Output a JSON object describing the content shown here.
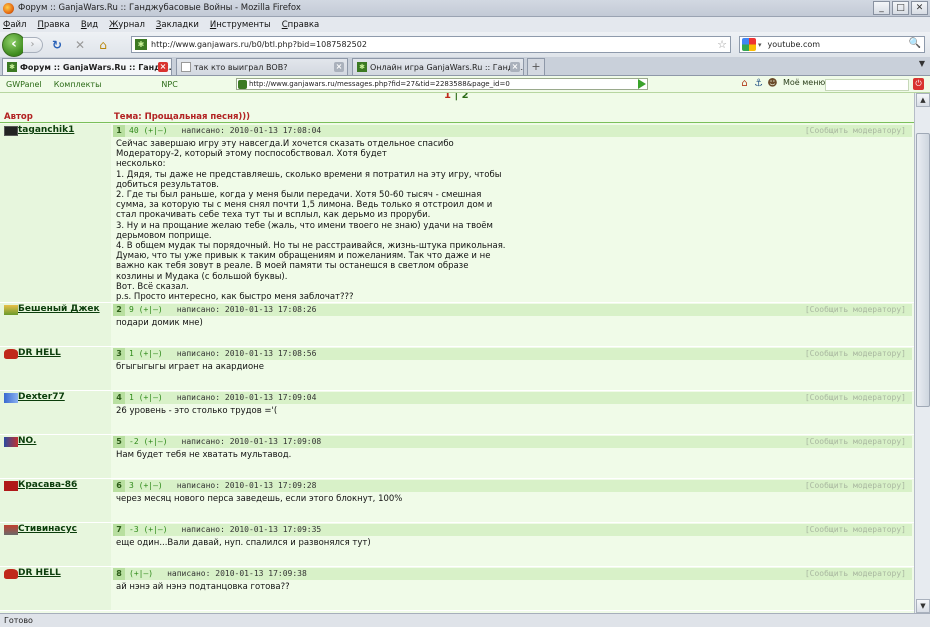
{
  "window": {
    "title": "Форум :: GanjaWars.Ru :: Ганджубасовые Войны - Mozilla Firefox",
    "buttons": [
      "_",
      "□",
      "✕"
    ]
  },
  "menu": [
    {
      "u": "Ф",
      "rest": "айл"
    },
    {
      "u": "П",
      "rest": "равка"
    },
    {
      "u": "В",
      "rest": "ид"
    },
    {
      "u": "Ж",
      "rest": "урнал"
    },
    {
      "u": "З",
      "rest": "акладки"
    },
    {
      "u": "И",
      "rest": "нструменты"
    },
    {
      "u": "С",
      "rest": "правка"
    }
  ],
  "nav": {
    "back": "‹",
    "forward": "›",
    "reload": "↻",
    "stop": "✕",
    "home": "⌂",
    "url": "http://www.ganjawars.ru/b0/btl.php?bid=1087582502",
    "search_value": "youtube.com"
  },
  "tabs": [
    {
      "label": "Форум :: GanjaWars.Ru :: Гандж...",
      "active": true
    },
    {
      "label": "так кто выиграл ВОВ?",
      "active": false
    },
    {
      "label": "Онлайн игра GanjaWars.Ru :: Гандж...",
      "active": false
    }
  ],
  "gwpanel": {
    "links": [
      "GWPanel",
      "Комплекты",
      "NPC"
    ],
    "url": "http://www.ganjawars.ru/messages.php?fid=27&tid=2283588&page_id=0",
    "my_menu": "Моё меню"
  },
  "forum": {
    "pager": {
      "current": "1",
      "next": "2"
    },
    "head_author": "Автор",
    "head_topic": "Тема: Прощальная песня)))",
    "report_label": "[Сообщить модератору]",
    "written_label": "написано:",
    "posts": [
      {
        "author": "taganchik1",
        "num": "1",
        "rating": "40 (+|—)",
        "date": "2010-01-13 17:08:04",
        "text": "Сейчас завершаю игру эту навсегда.И хочется сказать отдельное спасибо\nМодератору-2, который этому поспособствовал. Хотя будет\nнесколько:\n1. Дядя, ты даже не представляешь, сколько времени я потратил на эту игру, чтобы\nдобиться результатов.\n2. Где ты был раньше, когда у меня были передачи. Хотя 50-60 тысяч - смешная\nсумма, за которую ты с меня снял почти 1,5 лимона. Ведь только я отстроил дом и\nстал прокачивать себе теха тут ты и всплыл, как дерьмо из проруби.\n3. Ну и на прощание желаю тебе (жаль, что имени твоего не знаю) удачи на твоём\nдерьмовом поприще.\n4. В общем мудак ты порядочный. Но ты не расстраивайся, жизнь-штука прикольная.\nДумаю, что ты уже привык к таким обращениям и пожеланиям. Так что даже и не\nважно как тебя зовут в реале. В моей памяти ты останешся в светлом образе\nкозлины и Мудака (с большой буквы).\nВот. Всё сказал.\np.s. Просто интересно, как быстро меня заблочат???"
      },
      {
        "author": "Бешеный Джек",
        "num": "2",
        "rating": "9 (+|—)",
        "date": "2010-01-13 17:08:26",
        "text": "подари домик мне)"
      },
      {
        "author": "DR HELL",
        "num": "3",
        "rating": "1 (+|—)",
        "date": "2010-01-13 17:08:56",
        "text": "бгыгыгыгы играет на акардионе"
      },
      {
        "author": "Dexter77",
        "num": "4",
        "rating": "1 (+|—)",
        "date": "2010-01-13 17:09:04",
        "text": "26 уровень - это столько трудов ='("
      },
      {
        "author": "NO.",
        "num": "5",
        "rating": "-2 (+|—)",
        "date": "2010-01-13 17:09:08",
        "text": "Нам будет тебя не хватать мультавод."
      },
      {
        "author": "Красава-86",
        "num": "6",
        "rating": "3 (+|—)",
        "date": "2010-01-13 17:09:28",
        "text": "через месяц нового перса заведешь, если этого блокнут, 100%"
      },
      {
        "author": "Стивинасус",
        "num": "7",
        "rating": "-3 (+|—)",
        "date": "2010-01-13 17:09:35",
        "text": "еще один...Вали давай, нуп. спалился и развонялся тут)"
      },
      {
        "author": "DR HELL",
        "num": "8",
        "rating": "(+|—)",
        "date": "2010-01-13 17:09:38",
        "text": "ай нэнэ ай нэнэ подтанцовка готова??"
      }
    ]
  },
  "status": "Готово"
}
